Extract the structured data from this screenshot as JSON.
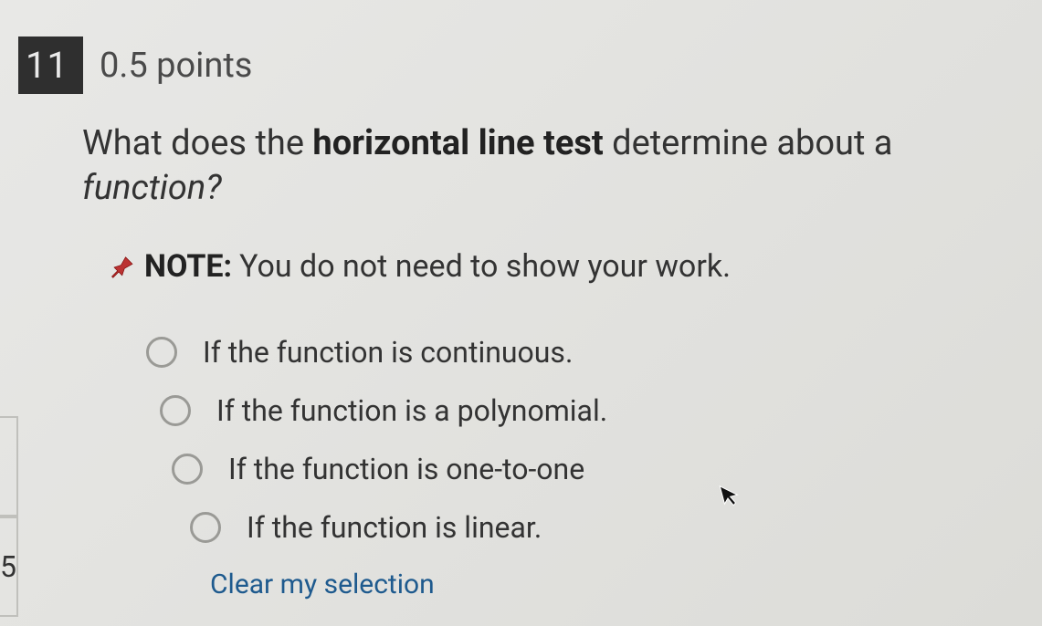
{
  "sidebar": {
    "page_number": "5"
  },
  "question": {
    "number": "11",
    "points": "0.5 points",
    "prompt_prefix": "What does the ",
    "prompt_bold": "horizontal line test",
    "prompt_mid": " determine about a ",
    "prompt_italic": "function?",
    "note_label": "NOTE:",
    "note_text": "You do not need to show your work.",
    "options": [
      "If the function is continuous.",
      "If the function is a polynomial.",
      "If the function is one-to-one",
      "If the function is linear."
    ],
    "clear": "Clear my selection"
  }
}
